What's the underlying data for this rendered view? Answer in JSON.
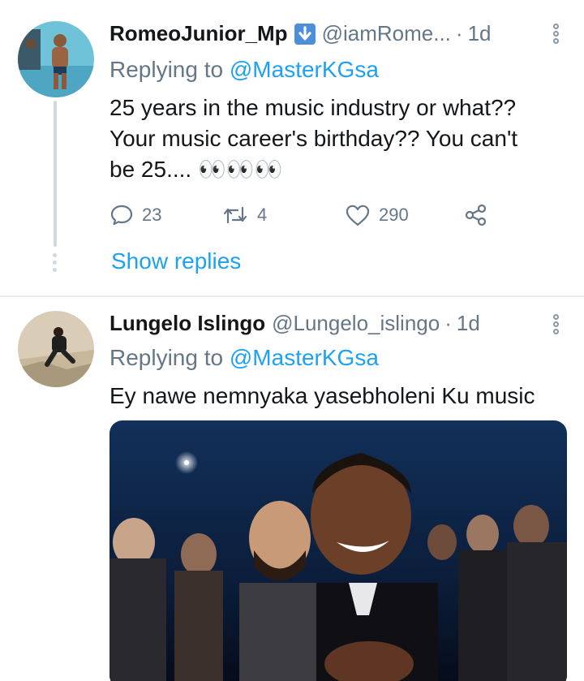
{
  "tweets": [
    {
      "display_name": "RomeoJunior_Mp",
      "handle": "@iamRome...",
      "separator": "·",
      "time": "1d",
      "reply_prefix": "Replying to",
      "reply_to": "@MasterKGsa",
      "text_lines": [
        "25 years in the music industry or what??",
        "Your music career's birthday?? You can't",
        "be 25.... 👀👀👀"
      ],
      "actions": {
        "replies": "23",
        "retweets": "4",
        "likes": "290"
      },
      "show_replies": "Show replies"
    },
    {
      "display_name": "Lungelo Islingo",
      "handle": "@Lungelo_islingo",
      "separator": "·",
      "time": "1d",
      "reply_prefix": "Replying to",
      "reply_to": "@MasterKGsa",
      "text_lines": [
        "Ey nawe nemnyaka yasebholeni Ku music"
      ]
    }
  ],
  "icons": {
    "verified_badge": "arrow-down-icon",
    "more": "vertical-ellipsis-icon",
    "reply": "speech-bubble-icon",
    "retweet": "retweet-icon",
    "like": "heart-icon",
    "share": "share-icon"
  },
  "colors": {
    "link": "#1da1f2",
    "muted": "#657786",
    "text": "#14171a",
    "badge": "#4c8ed9"
  }
}
